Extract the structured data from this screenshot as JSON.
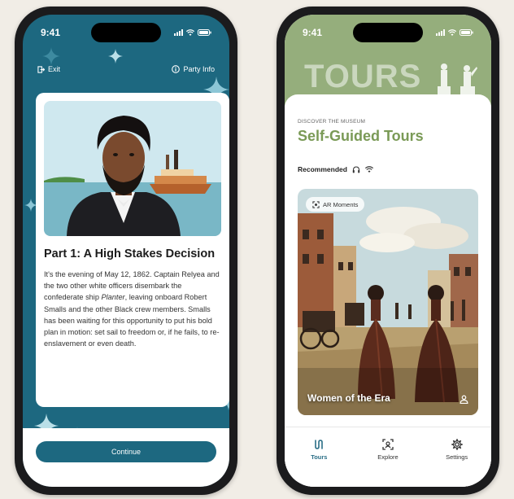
{
  "left_screen": {
    "status": {
      "time": "9:41"
    },
    "topbar": {
      "exit_label": "Exit",
      "party_info_label": "Party Info"
    },
    "story": {
      "title": "Part 1: A High Stakes Decision",
      "body_start": "It's the evening of May 12, 1862. Captain Relyea and the two other white officers disembark the confederate ship ",
      "body_ship": "Planter",
      "body_end": ", leaving onboard Robert Smalls and the other Black crew members. Smalls has been waiting for this opportunity to put his bold plan in motion: set sail to freedom or, if he fails, to re-enslavement or even death."
    },
    "continue_label": "Continue",
    "colors": {
      "primary": "#1d6880",
      "card": "#ffffff"
    }
  },
  "right_screen": {
    "status": {
      "time": "9:41"
    },
    "hero_word": "TOURS",
    "eyebrow": "DISCOVER THE MUSEUM",
    "heading": "Self-Guided Tours",
    "recommended_label": "Recommended",
    "tour_card": {
      "badge": "AR Moments",
      "title": "Women of the Era"
    },
    "tabs": [
      {
        "label": "Tours",
        "icon": "tours-icon",
        "active": true
      },
      {
        "label": "Explore",
        "icon": "explore-icon",
        "active": false
      },
      {
        "label": "Settings",
        "icon": "gear-icon",
        "active": false
      }
    ],
    "colors": {
      "accent": "#7a9a56",
      "hero": "#95ae7c",
      "active_tab": "#2a6e86"
    }
  }
}
